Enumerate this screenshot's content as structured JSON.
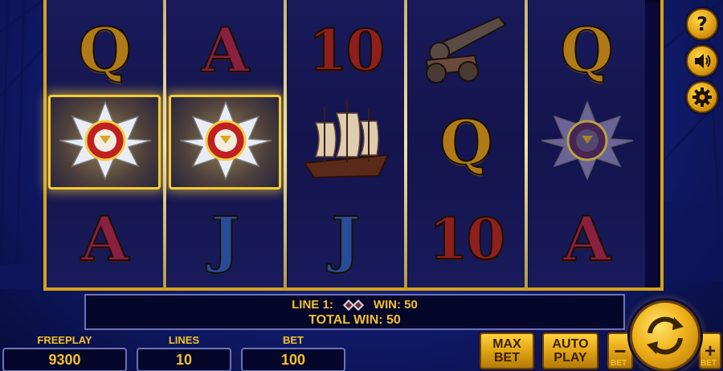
{
  "reels": [
    [
      {
        "type": "letter",
        "sym": "Q",
        "cls": "sym-q"
      },
      {
        "type": "star",
        "win": true
      },
      {
        "type": "letter",
        "sym": "A",
        "cls": "sym-a"
      }
    ],
    [
      {
        "type": "letter",
        "sym": "A",
        "cls": "sym-a"
      },
      {
        "type": "star",
        "win": true
      },
      {
        "type": "letter",
        "sym": "J",
        "cls": "sym-j"
      }
    ],
    [
      {
        "type": "letter",
        "sym": "10",
        "cls": "sym-10"
      },
      {
        "type": "ship"
      },
      {
        "type": "letter",
        "sym": "J",
        "cls": "sym-j"
      }
    ],
    [
      {
        "type": "cannon"
      },
      {
        "type": "letter",
        "sym": "Q",
        "cls": "sym-q"
      },
      {
        "type": "letter",
        "sym": "10",
        "cls": "sym-10"
      }
    ],
    [
      {
        "type": "letter",
        "sym": "Q",
        "cls": "sym-q"
      },
      {
        "type": "star-dim"
      },
      {
        "type": "letter",
        "sym": "A",
        "cls": "sym-a"
      }
    ]
  ],
  "info": {
    "line_label": "LINE 1:",
    "win_label": "WIN: 50",
    "total_win": "TOTAL WIN: 50"
  },
  "stats": {
    "freeplay_label": "FREEPLAY",
    "freeplay_value": "9300",
    "lines_label": "LINES",
    "lines_value": "10",
    "bet_label": "BET",
    "bet_value": "100"
  },
  "buttons": {
    "max_bet_1": "MAX",
    "max_bet_2": "BET",
    "auto_play_1": "AUTO",
    "auto_play_2": "PLAY",
    "bet_minus": "−",
    "bet_plus": "+",
    "bet_minus_label": "BET",
    "bet_plus_label": "BET",
    "help": "?"
  },
  "colors": {
    "gold": "#f4c12a",
    "frame": "#d6a21a",
    "panel": "#04062a"
  }
}
